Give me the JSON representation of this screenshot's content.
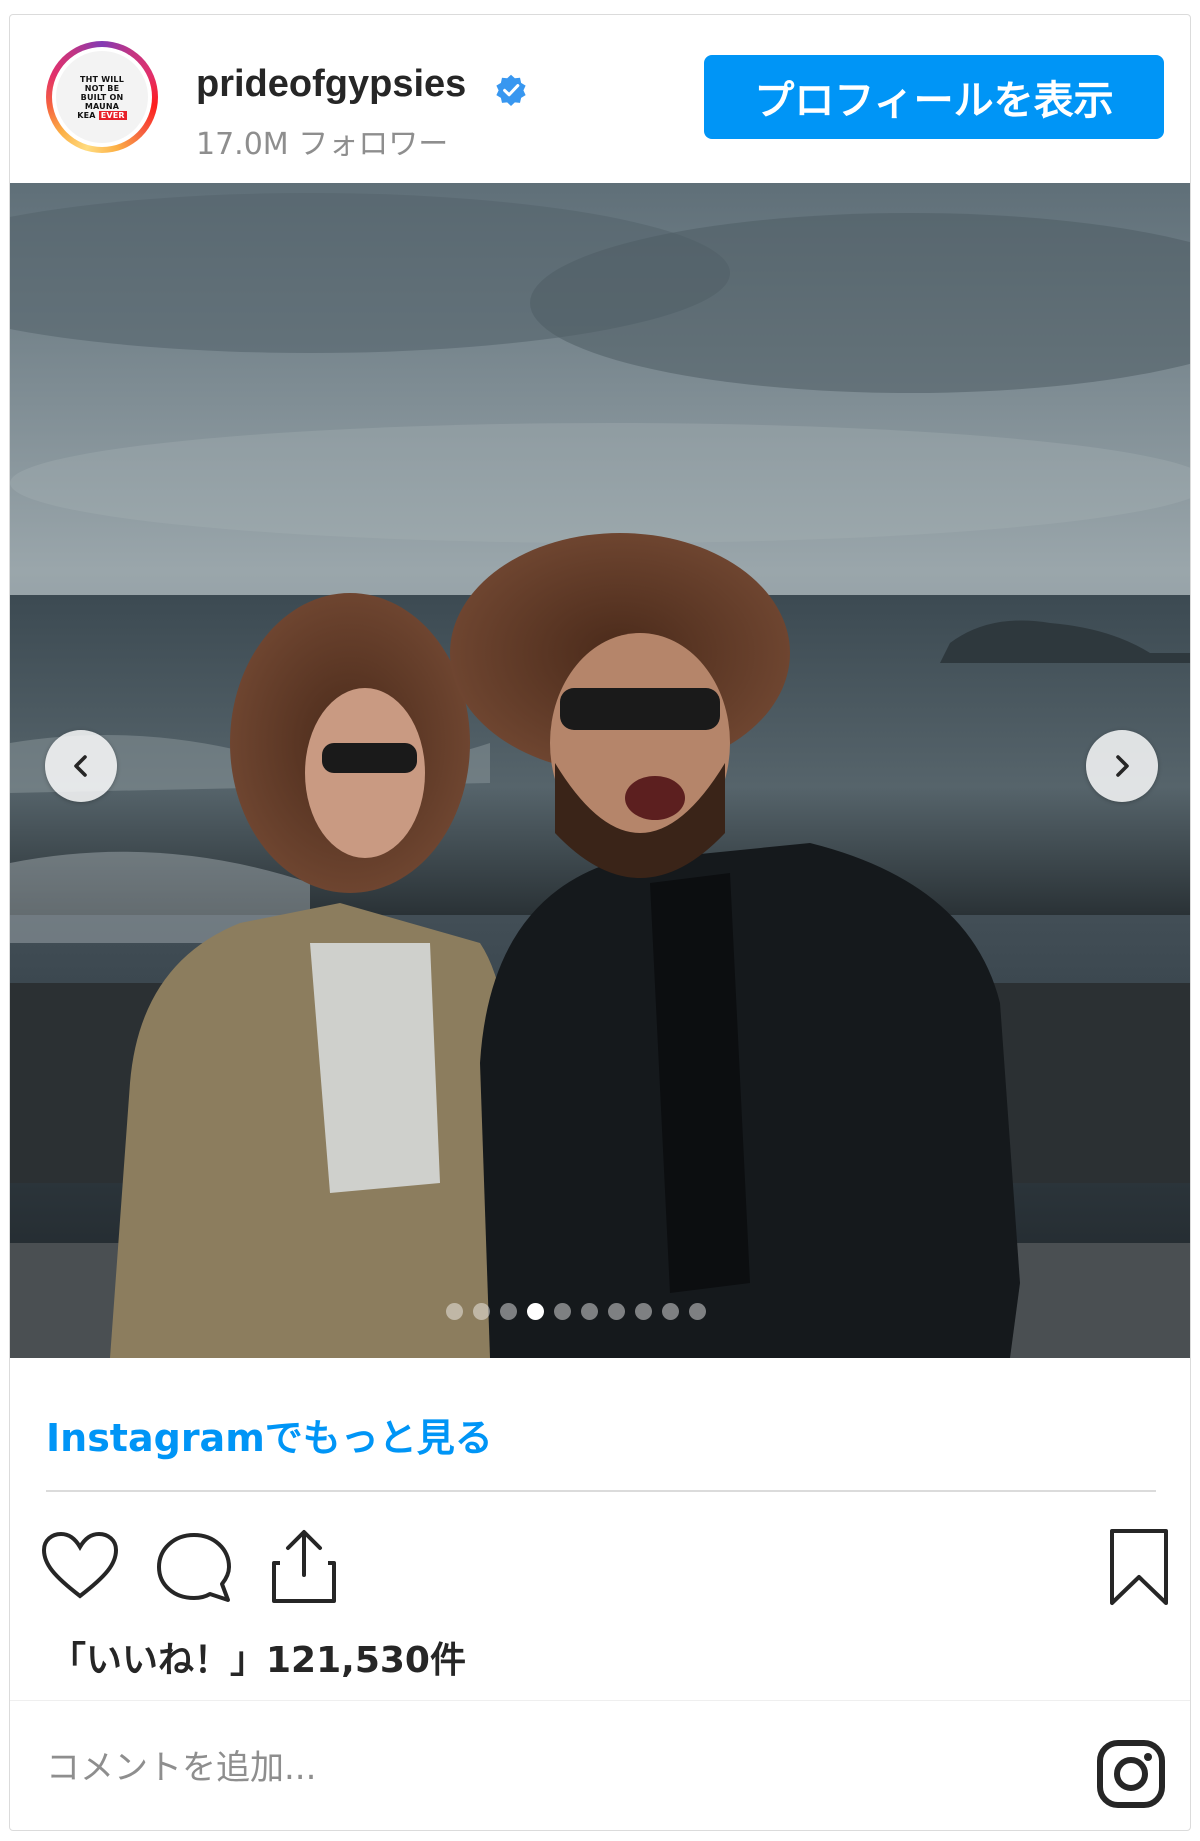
{
  "header": {
    "username": "prideofgypsies",
    "followers": "17.0M フォロワー",
    "profile_button": "プロフィールを表示",
    "avatar_text": [
      "THT WILL",
      "NOT BE",
      "BUILT ON",
      "MAUNA",
      "KEA"
    ],
    "avatar_badge": "EVER"
  },
  "photo": {
    "slide_count": 10,
    "active_slide": 4,
    "prev_icon": "chevron-left-icon",
    "next_icon": "chevron-right-icon"
  },
  "more_link": "Instagramでもっと見る",
  "actions": {
    "like_icon": "heart-icon",
    "comment_icon": "comment-icon",
    "share_icon": "share-icon",
    "save_icon": "bookmark-icon"
  },
  "likes": "「いいね！」121,530件",
  "comment": {
    "placeholder": "コメントを追加...",
    "instagram_icon": "instagram-icon"
  },
  "colors": {
    "accent": "#0095f6",
    "text": "#262626",
    "muted": "#8e8e8e",
    "border": "#dbdbdb"
  }
}
